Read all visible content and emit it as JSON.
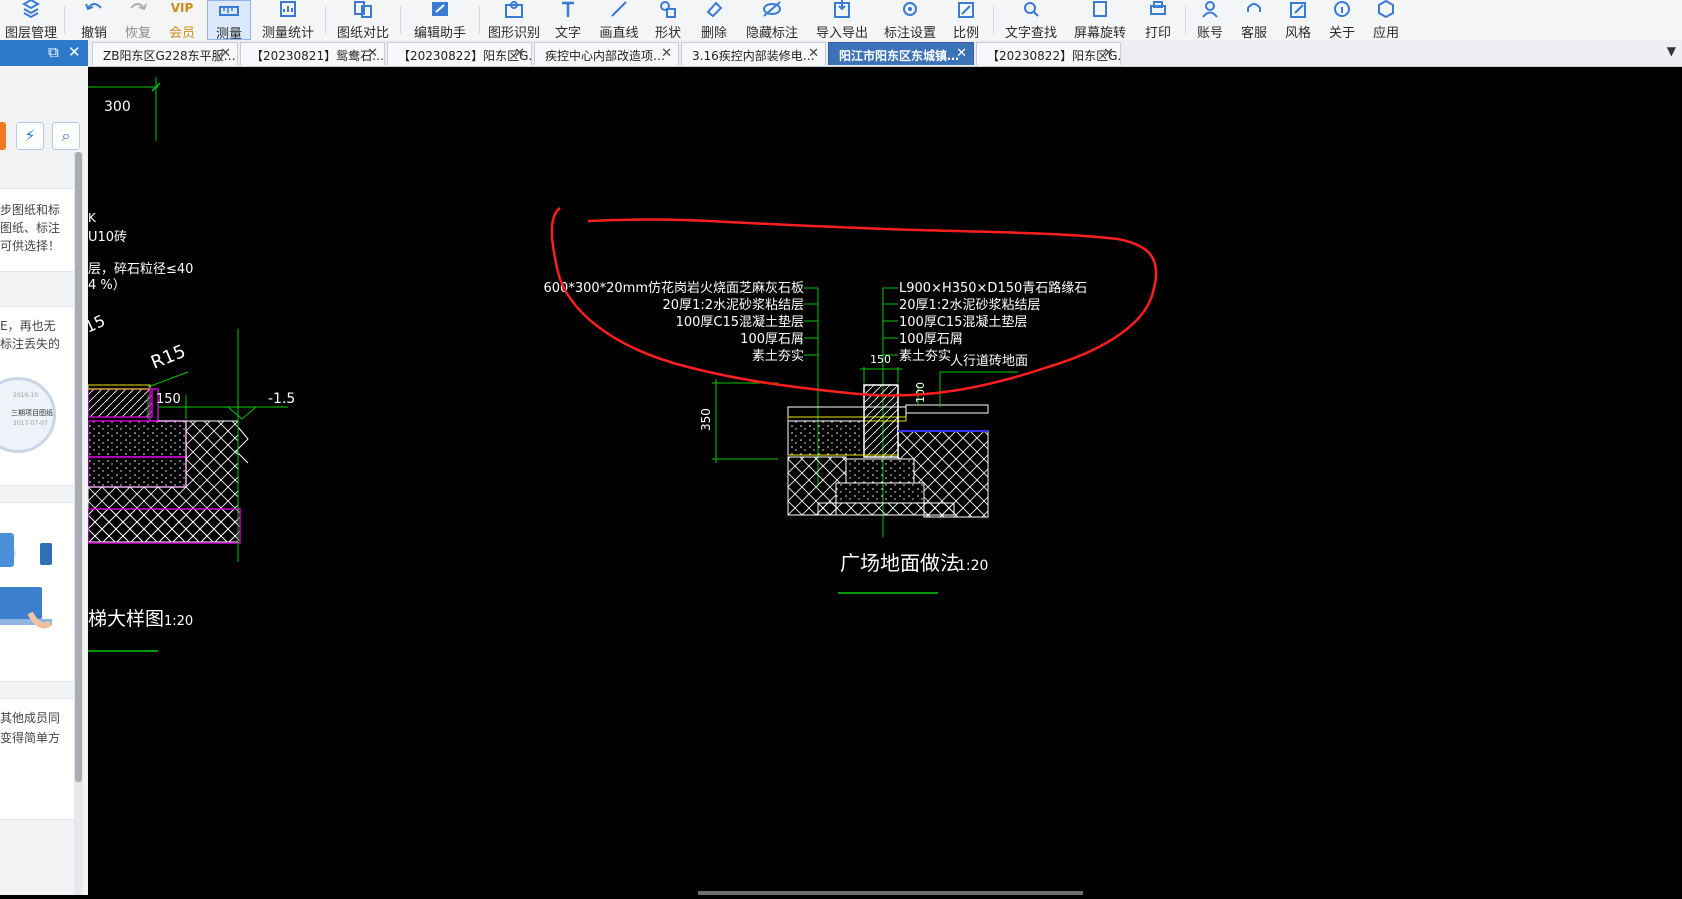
{
  "toolbar": {
    "items": [
      {
        "label": "图层管理",
        "icon": "layers-icon"
      },
      {
        "label": "撤销",
        "icon": "undo-icon"
      },
      {
        "label": "恢复",
        "icon": "redo-icon"
      },
      {
        "label": "会员",
        "icon": "vip-icon",
        "badge": "VIP"
      },
      {
        "label": "测量",
        "icon": "ruler-icon"
      },
      {
        "label": "测量统计",
        "icon": "measure-stats-icon"
      },
      {
        "label": "图纸对比",
        "icon": "compare-icon"
      },
      {
        "label": "编辑助手",
        "icon": "edit-assistant-icon"
      },
      {
        "label": "图形识别",
        "icon": "shape-recognition-icon"
      },
      {
        "label": "文字",
        "icon": "text-icon"
      },
      {
        "label": "画直线",
        "icon": "line-icon"
      },
      {
        "label": "形状",
        "icon": "shape-icon"
      },
      {
        "label": "删除",
        "icon": "eraser-icon"
      },
      {
        "label": "隐藏标注",
        "icon": "hide-annotation-icon"
      },
      {
        "label": "导入导出",
        "icon": "import-export-icon"
      },
      {
        "label": "标注设置",
        "icon": "annotation-settings-icon"
      },
      {
        "label": "比例",
        "icon": "scale-icon"
      },
      {
        "label": "文字查找",
        "icon": "text-search-icon"
      },
      {
        "label": "屏幕旋转",
        "icon": "rotate-screen-icon"
      },
      {
        "label": "打印",
        "icon": "print-icon"
      },
      {
        "label": "账号",
        "icon": "account-icon"
      },
      {
        "label": "客服",
        "icon": "customer-service-icon"
      },
      {
        "label": "风格",
        "icon": "style-icon"
      },
      {
        "label": "关于",
        "icon": "about-icon"
      },
      {
        "label": "应用",
        "icon": "apps-icon"
      }
    ]
  },
  "tabs": [
    {
      "label": "ZB阳东区G228东平服…"
    },
    {
      "label": "【20230821】鸳鸯石…"
    },
    {
      "label": "【20230822】阳东区G…"
    },
    {
      "label": "疾控中心内部改造项…"
    },
    {
      "label": "3.16疾控内部装修电…"
    },
    {
      "label": "阳江市阳东区东城镇…"
    },
    {
      "label": "【20230822】阳东区G…"
    }
  ],
  "left_panel": {
    "card1": [
      "步图纸和标",
      "图纸、标注",
      "可供选择！"
    ],
    "card2": [
      "E，再也无",
      "标注丢失的"
    ],
    "card2_thumb": {
      "date1": "2016-10",
      "title": "三期项目图纸",
      "date2": "2017-07-07"
    },
    "card4": [
      "其他成员同",
      "变得简单方"
    ]
  },
  "drawing": {
    "left_detail": {
      "dim_300": "300",
      "dim_150": "150",
      "elev": "-1.5",
      "radius": "R15",
      "r_cut": "15",
      "note_u10": "U10砖",
      "note_gravel": "层，碎石粒径≤40",
      "note_pct": "4 %）",
      "note_k": "K",
      "title": "梯大样图",
      "scale": "1:20"
    },
    "left_callouts": [
      "600*300*20mm仿花岗岩火烧面芝麻灰石板",
      "20厚1:2水泥砂浆粘结层",
      "100厚C15混凝土垫层",
      "100厚石屑",
      "素土夯实"
    ],
    "right_callouts": [
      "L900×H350×D150青石路缘石",
      "20厚1:2水泥砂浆粘结层",
      "100厚C15混凝土垫层",
      "100厚石屑",
      "素土夯实"
    ],
    "dims": {
      "d150": "150",
      "d100": "100",
      "d350": "350"
    },
    "sidewalk_label": "人行道砖地面",
    "section_title": "广场地面做法",
    "section_scale": "1:20",
    "colors": {
      "cad_green": "#00c800",
      "cad_magenta": "#c800c8",
      "cad_yellow": "#e6e600",
      "cad_blue": "#3232ff",
      "markup_red": "#ff1e1e",
      "cad_white": "#ffffff"
    }
  }
}
